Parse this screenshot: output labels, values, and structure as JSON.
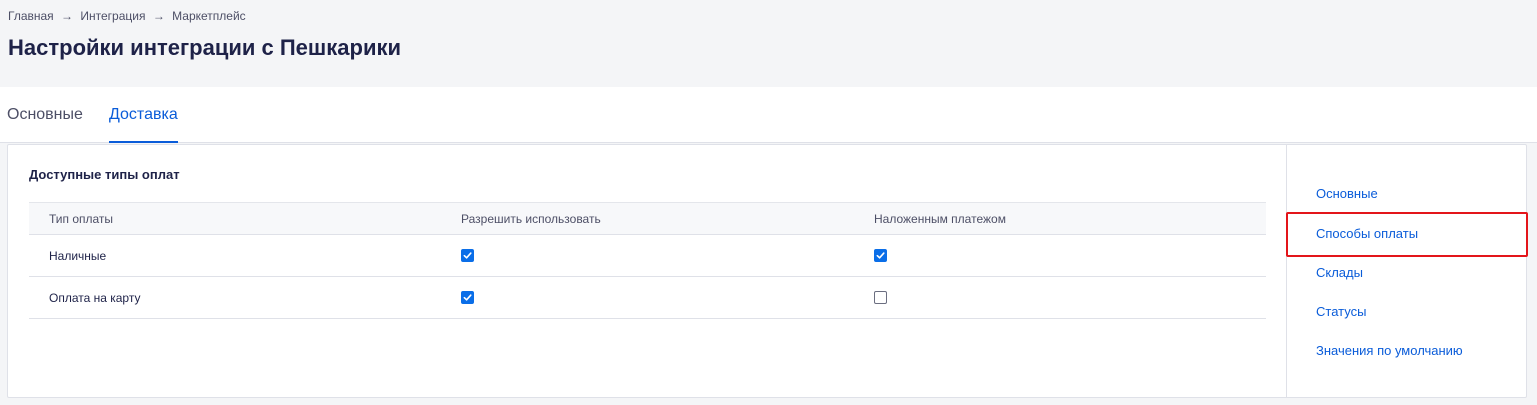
{
  "breadcrumb": {
    "items": [
      "Главная",
      "Интеграция",
      "Маркетплейс"
    ],
    "separator": "→"
  },
  "page": {
    "title": "Настройки интеграции с Пешкарики"
  },
  "tabs": [
    {
      "label": "Основные",
      "active": false
    },
    {
      "label": "Доставка",
      "active": true
    }
  ],
  "payment_types": {
    "title": "Доступные типы оплат",
    "columns": [
      "Тип оплаты",
      "Разрешить использовать",
      "Наложенным платежом"
    ],
    "rows": [
      {
        "name": "Наличные",
        "allow": true,
        "cod": true
      },
      {
        "name": "Оплата на карту",
        "allow": true,
        "cod": false
      }
    ]
  },
  "side_nav": {
    "items": [
      "Основные",
      "Способы оплаты",
      "Склады",
      "Статусы",
      "Значения по умолчанию"
    ],
    "highlighted_index": 1
  },
  "colors": {
    "accent": "#0a5cd9",
    "checkbox": "#0a6ee8",
    "highlight": "#e3151a",
    "text": "#1e2248"
  }
}
